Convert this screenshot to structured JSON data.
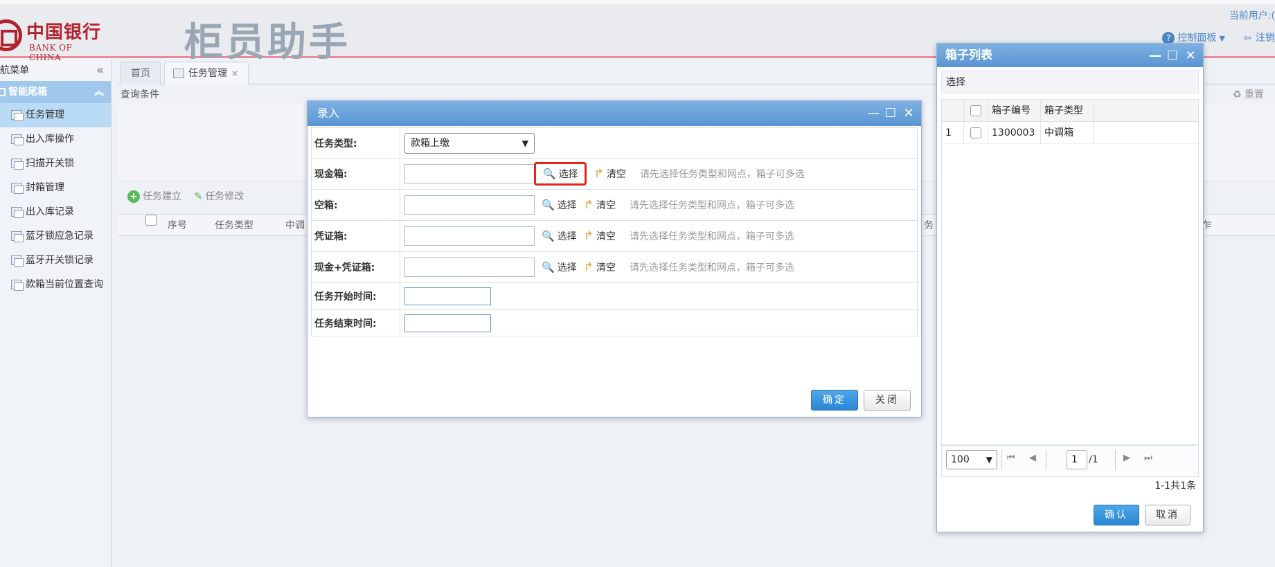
{
  "header": {
    "bank_name_cn": "中国银行",
    "bank_name_en": "BANK OF CHINA",
    "app_title": "柜员助手",
    "current_user": "当前用户:(",
    "control_panel": "控制面板",
    "logout": "注销"
  },
  "sidebar": {
    "title": "航菜单",
    "group": "智能尾箱",
    "items": [
      {
        "label": "任务管理",
        "active": true
      },
      {
        "label": "出入库操作"
      },
      {
        "label": "扫描开关锁"
      },
      {
        "label": "封箱管理"
      },
      {
        "label": "出入库记录"
      },
      {
        "label": "蓝牙锁应急记录"
      },
      {
        "label": "蓝牙开关锁记录"
      },
      {
        "label": "款箱当前位置查询"
      }
    ]
  },
  "tabs": {
    "home": "首页",
    "task": "任务管理"
  },
  "query": {
    "title": "查询条件",
    "reset": "重置"
  },
  "toolbar": {
    "create": "任务建立",
    "modify": "任务修改"
  },
  "grid": {
    "col_seq": "序号",
    "col_type": "任务类型",
    "col_mid": "中调",
    "col_task_partial": "务",
    "col_end_partial": "乍"
  },
  "entry_dialog": {
    "title": "录入",
    "task_type_label": "任务类型:",
    "task_type_value": "款箱上缴",
    "cash_box_label": "现金箱:",
    "empty_box_label": "空箱:",
    "voucher_box_label": "凭证箱:",
    "cash_voucher_box_label": "现金+凭证箱:",
    "start_time_label": "任务开始时间:",
    "end_time_label": "任务结束时间:",
    "select": "选择",
    "clear": "清空",
    "hint": "请先选择任务类型和网点，箱子可多选",
    "ok": "确定",
    "close": "关闭"
  },
  "box_dialog": {
    "title": "箱子列表",
    "select_bar": "选择",
    "col_code": "箱子编号",
    "col_type": "箱子类型",
    "rows": [
      {
        "index": "1",
        "code": "1300003",
        "type": "中调箱"
      }
    ],
    "page_size": "100",
    "page": "1",
    "page_total": "/1",
    "record_info": "1-1共1条",
    "ok": "确认",
    "cancel": "取消"
  }
}
